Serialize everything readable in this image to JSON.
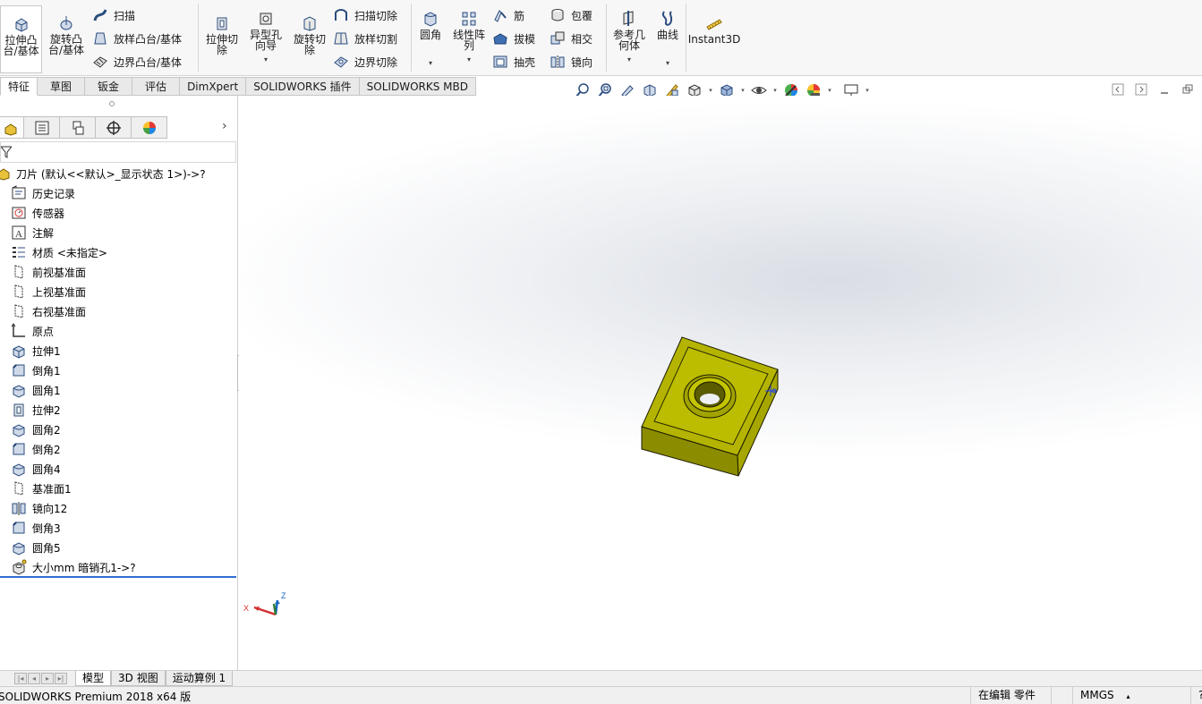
{
  "ribbon": {
    "extrude_boss": "拉伸凸\n台/基体",
    "revolve_boss": "旋转凸\n台/基体",
    "sweep": "扫描",
    "loft_boss": "放样凸台/基体",
    "boundary_boss": "边界凸台/基体",
    "extrude_cut": "拉伸切\n除",
    "hole_wizard": "异型孔\n向导",
    "revolve_cut": "旋转切\n除",
    "swept_cut": "扫描切除",
    "lofted_cut": "放样切割",
    "boundary_cut": "边界切除",
    "fillet": "圆角",
    "linear_pattern": "线性阵\n列",
    "rib": "筋",
    "draft": "拔模",
    "shell": "抽壳",
    "wrap": "包覆",
    "intersect": "相交",
    "mirror": "镜向",
    "ref_geometry": "参考几\n何体",
    "curves": "曲线",
    "instant3d": "Instant3D"
  },
  "cmd_tabs": [
    "特征",
    "草图",
    "钣金",
    "评估",
    "DimXpert",
    "SOLIDWORKS 插件",
    "SOLIDWORKS MBD"
  ],
  "tree": {
    "root": "刀片 (默认<<默认>_显示状态 1>)->?",
    "items": [
      {
        "label": "历史记录",
        "icon": "history-icon"
      },
      {
        "label": "传感器",
        "icon": "sensor-icon"
      },
      {
        "label": "注解",
        "icon": "annotation-icon"
      },
      {
        "label": "材质 <未指定>",
        "icon": "material-icon"
      },
      {
        "label": "前视基准面",
        "icon": "plane-icon"
      },
      {
        "label": "上视基准面",
        "icon": "plane-icon"
      },
      {
        "label": "右视基准面",
        "icon": "plane-icon"
      },
      {
        "label": "原点",
        "icon": "origin-icon"
      },
      {
        "label": "拉伸1",
        "icon": "extrude-icon"
      },
      {
        "label": "倒角1",
        "icon": "chamfer-icon"
      },
      {
        "label": "圆角1",
        "icon": "fillet-icon"
      },
      {
        "label": "拉伸2",
        "icon": "extrude-cut-icon"
      },
      {
        "label": "圆角2",
        "icon": "fillet-icon"
      },
      {
        "label": "倒角2",
        "icon": "chamfer-icon"
      },
      {
        "label": "圆角4",
        "icon": "fillet-icon"
      },
      {
        "label": "基准面1",
        "icon": "plane-icon"
      },
      {
        "label": "镜向12",
        "icon": "mirror-icon"
      },
      {
        "label": "倒角3",
        "icon": "chamfer-icon"
      },
      {
        "label": "圆角5",
        "icon": "fillet-icon"
      },
      {
        "label": "大小mm 暗销孔1->?",
        "icon": "hole-icon"
      }
    ]
  },
  "triad": {
    "x": "X",
    "z": "Z"
  },
  "bottom_tabs": [
    "模型",
    "3D 视图",
    "运动算例 1"
  ],
  "status": {
    "app": "SOLIDWORKS Premium 2018 x64 版",
    "mode": "在编辑 零件",
    "units": "MMGS"
  },
  "colors": {
    "model": "#b4b400",
    "accent": "#2f6fd0"
  }
}
